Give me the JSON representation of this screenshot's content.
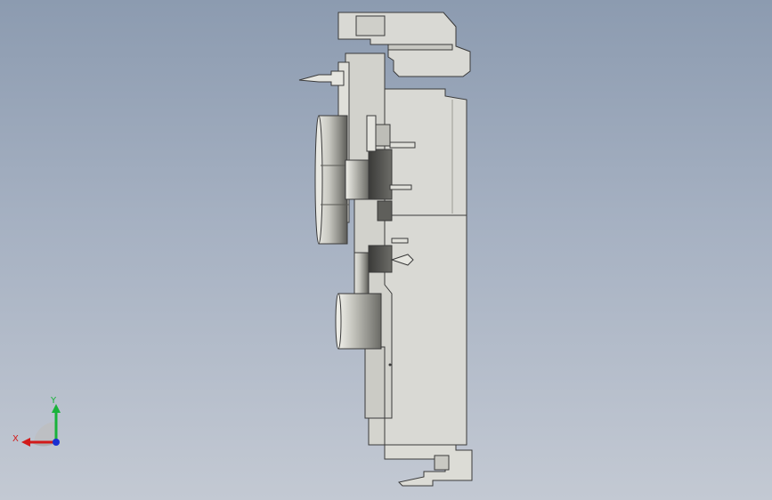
{
  "view": {
    "background_top": "#8c9bb0",
    "background_bottom": "#c3c9d3"
  },
  "part": {
    "body_color": "#d9d9d4",
    "edge_color": "#3a3a3a",
    "shadow_color": "#4a4a4a"
  },
  "triad": {
    "x_label": "X",
    "y_label": "Y",
    "x_color": "#d21a1a",
    "y_color": "#19b23a",
    "z_color": "#1a2fd2"
  }
}
